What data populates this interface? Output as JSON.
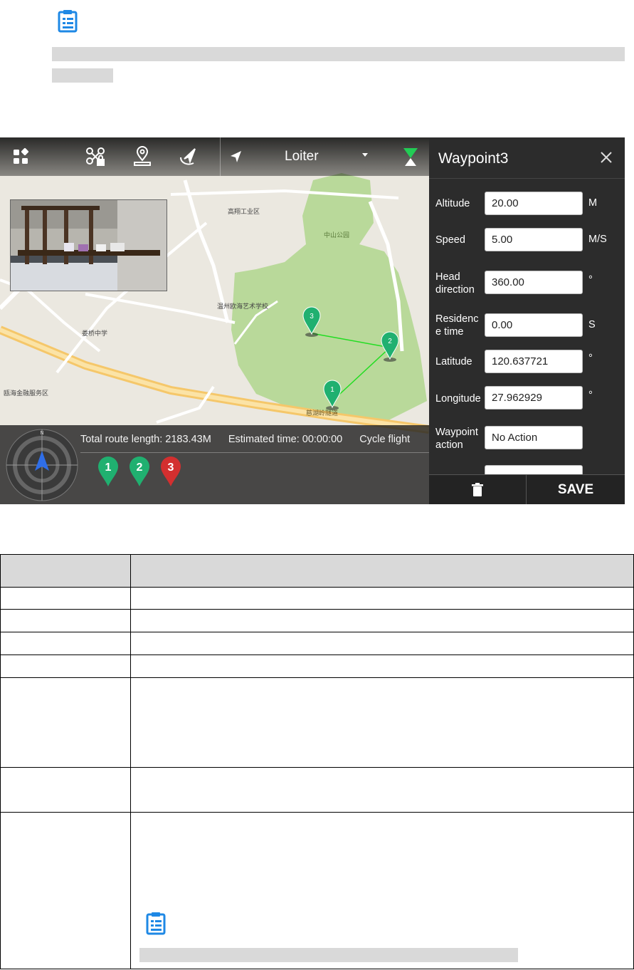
{
  "top_note": {
    "icon": "note-icon"
  },
  "app": {
    "toolbar": {
      "flight_mode": "Loiter",
      "icons": [
        "modules-icon",
        "drone-lock-icon",
        "location-pin-icon",
        "route-send-icon",
        "navigation-arrow-icon",
        "signal-icon"
      ]
    },
    "map_labels": {
      "industrial_zone": "高翔工业区",
      "zhongshan_park": "中山公园",
      "art_school": "温州欧海艺术学校",
      "tunnel": "慈湖岭隧道",
      "middle_school": "娄桥中学",
      "finance_center": "瓯海金融服务区"
    },
    "stats": {
      "route_length": "Total route length: 2183.43M",
      "estimated_time": "Estimated time: 00:00:00",
      "cycle": "Cycle flight"
    },
    "waypoints": [
      {
        "label": "1",
        "color": "#20b070"
      },
      {
        "label": "2",
        "color": "#20b070"
      },
      {
        "label": "3",
        "color": "#d32f2f"
      }
    ],
    "panel": {
      "title": "Waypoint3",
      "fields": [
        {
          "label": "Altitude",
          "value": "20.00",
          "unit": "M"
        },
        {
          "label": "Speed",
          "value": "5.00",
          "unit": "M/S"
        },
        {
          "label": "Head direction",
          "value": "360.00",
          "unit": "°"
        },
        {
          "label": "Residence time",
          "value": "0.00",
          "unit": "S"
        },
        {
          "label": "Latitude",
          "value": "120.637721",
          "unit": "°"
        },
        {
          "label": "Longitude",
          "value": "27.962929",
          "unit": "°"
        },
        {
          "label": "Waypoint action",
          "value": "No Action",
          "unit": ""
        }
      ],
      "save_label": "SAVE"
    }
  },
  "table": {
    "accent": "#1e88e5"
  }
}
